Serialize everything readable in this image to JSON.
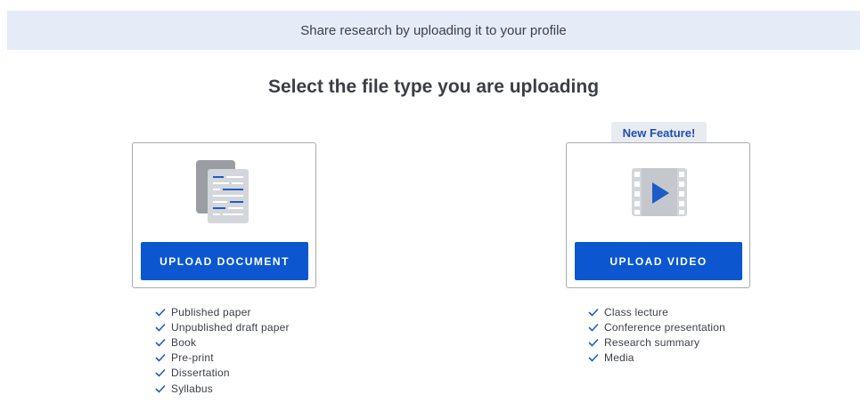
{
  "banner": {
    "text": "Share research by uploading it to your profile"
  },
  "page_title": "Select the file type you are uploading",
  "document_card": {
    "button_label": "UPLOAD DOCUMENT",
    "icon": "document-icon",
    "items": [
      "Published paper",
      "Unpublished draft paper",
      "Book",
      "Pre-print",
      "Dissertation",
      "Syllabus"
    ]
  },
  "video_card": {
    "badge": "New Feature!",
    "button_label": "UPLOAD VIDEO",
    "icon": "film-play-icon",
    "items": [
      "Class lecture",
      "Conference presentation",
      "Research summary",
      "Media"
    ]
  },
  "colors": {
    "accent": "#0c57d0",
    "banner_bg": "#e5ecf7",
    "badge_text": "#1e4fb3",
    "check": "#1e5bc6"
  }
}
